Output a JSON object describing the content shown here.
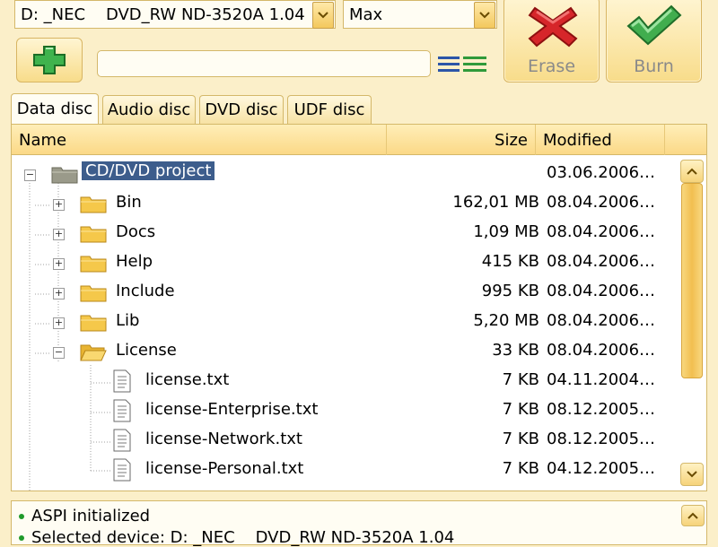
{
  "toolbar": {
    "drive": "D: _NEC    DVD_RW ND-3520A 1.04",
    "speed": "Max",
    "erase_label": "Erase",
    "burn_label": "Burn",
    "path_value": ""
  },
  "tabs": [
    "Data disc",
    "Audio disc",
    "DVD disc",
    "UDF disc"
  ],
  "columns": {
    "name": "Name",
    "size": "Size",
    "modified": "Modified"
  },
  "rows": [
    {
      "name": "CD/DVD project",
      "size": "",
      "modified": "03.06.2006…",
      "type": "root-folder"
    },
    {
      "name": "Bin",
      "size": "162,01 MB",
      "modified": "08.04.2006…",
      "type": "folder"
    },
    {
      "name": "Docs",
      "size": "1,09 MB",
      "modified": "08.04.2006…",
      "type": "folder"
    },
    {
      "name": "Help",
      "size": "415 KB",
      "modified": "08.04.2006…",
      "type": "folder"
    },
    {
      "name": "Include",
      "size": "995 KB",
      "modified": "08.04.2006…",
      "type": "folder"
    },
    {
      "name": "Lib",
      "size": "5,20 MB",
      "modified": "08.04.2006…",
      "type": "folder"
    },
    {
      "name": "License",
      "size": "33 KB",
      "modified": "08.04.2006…",
      "type": "open-folder"
    },
    {
      "name": "license.txt",
      "size": "7 KB",
      "modified": "04.11.2004…",
      "type": "file"
    },
    {
      "name": "license-Enterprise.txt",
      "size": "7 KB",
      "modified": "08.12.2005…",
      "type": "file"
    },
    {
      "name": "license-Network.txt",
      "size": "7 KB",
      "modified": "08.12.2005…",
      "type": "file"
    },
    {
      "name": "license-Personal.txt",
      "size": "7 KB",
      "modified": "04.12.2005…",
      "type": "file"
    }
  ],
  "log": [
    "ASPI initialized",
    "Selected device: D: _NEC    DVD_RW ND-3520A 1.04"
  ],
  "colors": {
    "accent": "#fbd987",
    "selection": "#3d5d8c",
    "erase": "#d6262a",
    "burn": "#3aa34a"
  }
}
